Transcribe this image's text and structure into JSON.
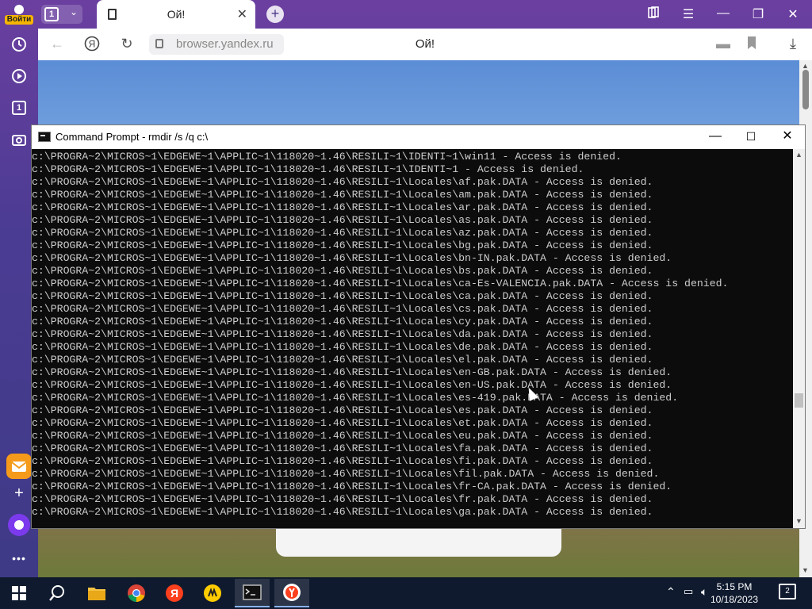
{
  "browser": {
    "login_label": "Войти",
    "tab_count": "1",
    "active_tab_title": "Ой!",
    "url": "browser.yandex.ru",
    "page_title": "Ой!",
    "rail_tab_count": "1"
  },
  "cmd": {
    "title": "Command Prompt - rmdir  /s /q c:\\",
    "lines": [
      "c:\\PROGRA~2\\MICROS~1\\EDGEWE~1\\APPLIC~1\\118020~1.46\\RESILI~1\\IDENTI~1\\win11 - Access is denied.",
      "c:\\PROGRA~2\\MICROS~1\\EDGEWE~1\\APPLIC~1\\118020~1.46\\RESILI~1\\IDENTI~1 - Access is denied.",
      "c:\\PROGRA~2\\MICROS~1\\EDGEWE~1\\APPLIC~1\\118020~1.46\\RESILI~1\\Locales\\af.pak.DATA - Access is denied.",
      "c:\\PROGRA~2\\MICROS~1\\EDGEWE~1\\APPLIC~1\\118020~1.46\\RESILI~1\\Locales\\am.pak.DATA - Access is denied.",
      "c:\\PROGRA~2\\MICROS~1\\EDGEWE~1\\APPLIC~1\\118020~1.46\\RESILI~1\\Locales\\ar.pak.DATA - Access is denied.",
      "c:\\PROGRA~2\\MICROS~1\\EDGEWE~1\\APPLIC~1\\118020~1.46\\RESILI~1\\Locales\\as.pak.DATA - Access is denied.",
      "c:\\PROGRA~2\\MICROS~1\\EDGEWE~1\\APPLIC~1\\118020~1.46\\RESILI~1\\Locales\\az.pak.DATA - Access is denied.",
      "c:\\PROGRA~2\\MICROS~1\\EDGEWE~1\\APPLIC~1\\118020~1.46\\RESILI~1\\Locales\\bg.pak.DATA - Access is denied.",
      "c:\\PROGRA~2\\MICROS~1\\EDGEWE~1\\APPLIC~1\\118020~1.46\\RESILI~1\\Locales\\bn-IN.pak.DATA - Access is denied.",
      "c:\\PROGRA~2\\MICROS~1\\EDGEWE~1\\APPLIC~1\\118020~1.46\\RESILI~1\\Locales\\bs.pak.DATA - Access is denied.",
      "c:\\PROGRA~2\\MICROS~1\\EDGEWE~1\\APPLIC~1\\118020~1.46\\RESILI~1\\Locales\\ca-Es-VALENCIA.pak.DATA - Access is denied.",
      "c:\\PROGRA~2\\MICROS~1\\EDGEWE~1\\APPLIC~1\\118020~1.46\\RESILI~1\\Locales\\ca.pak.DATA - Access is denied.",
      "c:\\PROGRA~2\\MICROS~1\\EDGEWE~1\\APPLIC~1\\118020~1.46\\RESILI~1\\Locales\\cs.pak.DATA - Access is denied.",
      "c:\\PROGRA~2\\MICROS~1\\EDGEWE~1\\APPLIC~1\\118020~1.46\\RESILI~1\\Locales\\cy.pak.DATA - Access is denied.",
      "c:\\PROGRA~2\\MICROS~1\\EDGEWE~1\\APPLIC~1\\118020~1.46\\RESILI~1\\Locales\\da.pak.DATA - Access is denied.",
      "c:\\PROGRA~2\\MICROS~1\\EDGEWE~1\\APPLIC~1\\118020~1.46\\RESILI~1\\Locales\\de.pak.DATA - Access is denied.",
      "c:\\PROGRA~2\\MICROS~1\\EDGEWE~1\\APPLIC~1\\118020~1.46\\RESILI~1\\Locales\\el.pak.DATA - Access is denied.",
      "c:\\PROGRA~2\\MICROS~1\\EDGEWE~1\\APPLIC~1\\118020~1.46\\RESILI~1\\Locales\\en-GB.pak.DATA - Access is denied.",
      "c:\\PROGRA~2\\MICROS~1\\EDGEWE~1\\APPLIC~1\\118020~1.46\\RESILI~1\\Locales\\en-US.pak.DATA - Access is denied.",
      "c:\\PROGRA~2\\MICROS~1\\EDGEWE~1\\APPLIC~1\\118020~1.46\\RESILI~1\\Locales\\es-419.pak.DATA - Access is denied.",
      "c:\\PROGRA~2\\MICROS~1\\EDGEWE~1\\APPLIC~1\\118020~1.46\\RESILI~1\\Locales\\es.pak.DATA - Access is denied.",
      "c:\\PROGRA~2\\MICROS~1\\EDGEWE~1\\APPLIC~1\\118020~1.46\\RESILI~1\\Locales\\et.pak.DATA - Access is denied.",
      "c:\\PROGRA~2\\MICROS~1\\EDGEWE~1\\APPLIC~1\\118020~1.46\\RESILI~1\\Locales\\eu.pak.DATA - Access is denied.",
      "c:\\PROGRA~2\\MICROS~1\\EDGEWE~1\\APPLIC~1\\118020~1.46\\RESILI~1\\Locales\\fa.pak.DATA - Access is denied.",
      "c:\\PROGRA~2\\MICROS~1\\EDGEWE~1\\APPLIC~1\\118020~1.46\\RESILI~1\\Locales\\fi.pak.DATA - Access is denied.",
      "c:\\PROGRA~2\\MICROS~1\\EDGEWE~1\\APPLIC~1\\118020~1.46\\RESILI~1\\Locales\\fil.pak.DATA - Access is denied.",
      "c:\\PROGRA~2\\MICROS~1\\EDGEWE~1\\APPLIC~1\\118020~1.46\\RESILI~1\\Locales\\fr-CA.pak.DATA - Access is denied.",
      "c:\\PROGRA~2\\MICROS~1\\EDGEWE~1\\APPLIC~1\\118020~1.46\\RESILI~1\\Locales\\fr.pak.DATA - Access is denied.",
      "c:\\PROGRA~2\\MICROS~1\\EDGEWE~1\\APPLIC~1\\118020~1.46\\RESILI~1\\Locales\\ga.pak.DATA - Access is denied."
    ]
  },
  "taskbar": {
    "time": "5:15 PM",
    "date": "10/18/2023",
    "notification_count": "2",
    "pinned": [
      "windows-start",
      "search",
      "file-explorer",
      "chrome",
      "yandex",
      "yandex-music",
      "command-prompt",
      "yandex-browser"
    ]
  },
  "colors": {
    "browser_accent": "#4a3a8a",
    "terminal_bg": "#0c0c0c",
    "terminal_fg": "#cccccc",
    "taskbar_bg": "#0f1a2e",
    "login_badge": "#f5b400"
  }
}
